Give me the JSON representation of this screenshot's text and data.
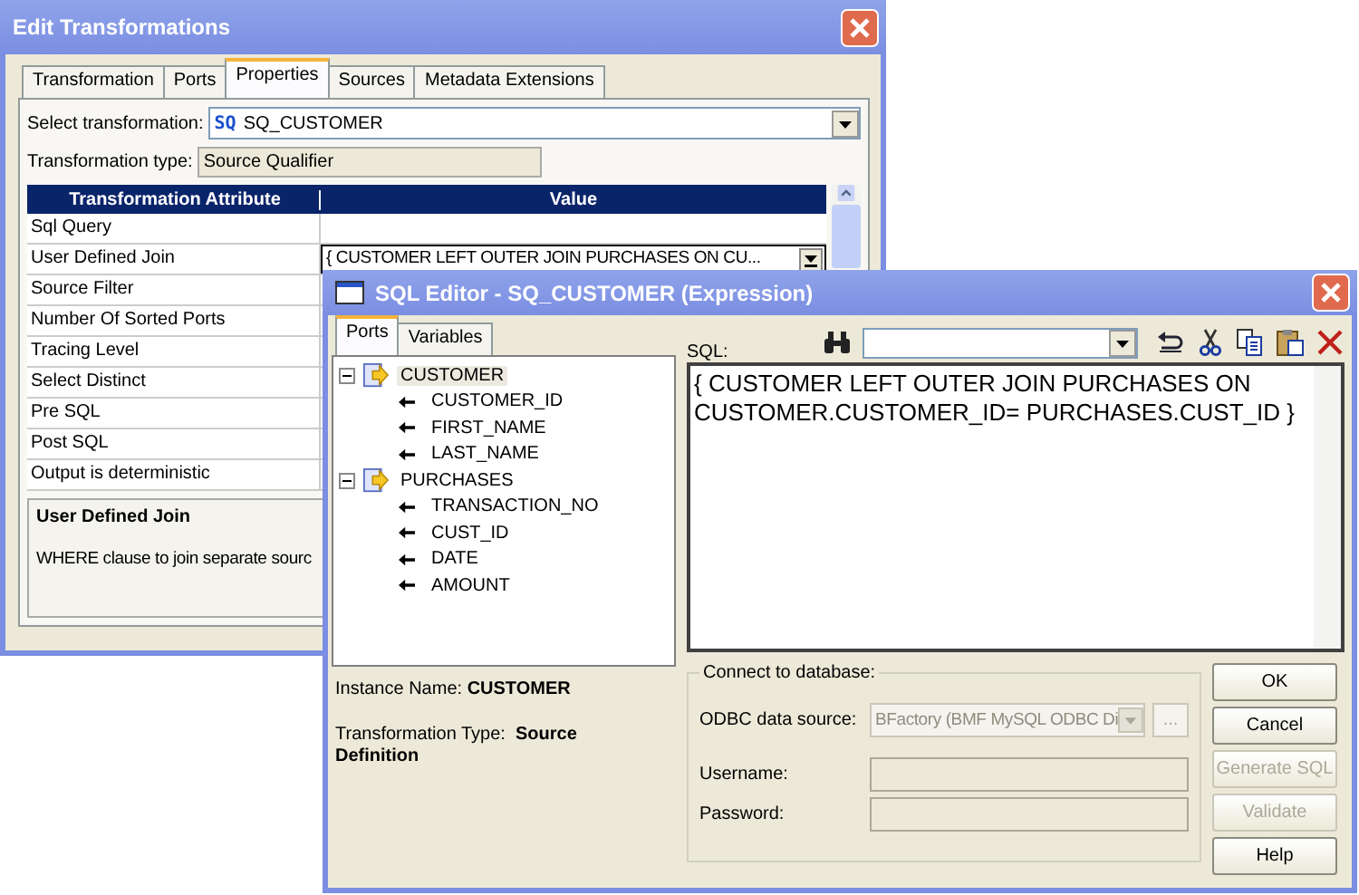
{
  "back_window": {
    "title": "Edit Transformations",
    "tabs": [
      {
        "label": "Transformation",
        "selected": false
      },
      {
        "label": "Ports",
        "selected": false
      },
      {
        "label": "Properties",
        "selected": true
      },
      {
        "label": "Sources",
        "selected": false
      },
      {
        "label": "Metadata Extensions",
        "selected": false
      }
    ],
    "select_transformation": {
      "label": "Select transformation:",
      "badge": "SQ",
      "value": "SQ_CUSTOMER"
    },
    "transformation_type": {
      "label": "Transformation type:",
      "value": "Source Qualifier"
    },
    "table": {
      "columns": [
        "Transformation Attribute",
        "Value"
      ],
      "rows": [
        {
          "attribute": "Sql Query"
        },
        {
          "attribute": "User Defined Join",
          "value": "{ CUSTOMER LEFT OUTER JOIN PURCHASES ON CU..."
        },
        {
          "attribute": "Source Filter"
        },
        {
          "attribute": "Number Of Sorted Ports"
        },
        {
          "attribute": "Tracing Level"
        },
        {
          "attribute": "Select Distinct"
        },
        {
          "attribute": "Pre SQL"
        },
        {
          "attribute": "Post SQL"
        },
        {
          "attribute": "Output is deterministic"
        }
      ]
    },
    "description": {
      "title": "User Defined Join",
      "text": "WHERE clause to join separate sourc"
    }
  },
  "front_window": {
    "title": "SQL Editor - SQ_CUSTOMER (Expression)",
    "tabs": [
      {
        "label": "Ports",
        "selected": true
      },
      {
        "label": "Variables",
        "selected": false
      }
    ],
    "tree": [
      {
        "label": "CUSTOMER",
        "selected": true,
        "expanded": true,
        "children": [
          {
            "label": "CUSTOMER_ID",
            "selected": false
          },
          {
            "label": "FIRST_NAME",
            "selected": false
          },
          {
            "label": "LAST_NAME",
            "selected": false
          }
        ]
      },
      {
        "label": "PURCHASES",
        "selected": false,
        "expanded": true,
        "children": [
          {
            "label": "TRANSACTION_NO",
            "selected": false
          },
          {
            "label": "CUST_ID",
            "selected": false
          },
          {
            "label": "DATE",
            "selected": false
          },
          {
            "label": "AMOUNT",
            "selected": false
          }
        ]
      }
    ],
    "instance_name": {
      "label": "Instance Name:",
      "value": "CUSTOMER"
    },
    "transformation_type": {
      "label": "Transformation Type:",
      "value": "Source Definition"
    },
    "sql_label": "SQL:",
    "sql_lines": [
      "{ CUSTOMER LEFT OUTER JOIN PURCHASES ON",
      "CUSTOMER.CUSTOMER_ID= PURCHASES.CUST_ID }"
    ],
    "connect": {
      "title": "Connect to database:",
      "odbc_label": "ODBC data source:",
      "odbc_value": "BFactory (BMF MySQL ODBC Di",
      "browse": "...",
      "username_label": "Username:",
      "password_label": "Password:"
    },
    "buttons": [
      {
        "label": "OK",
        "disabled": false
      },
      {
        "label": "Cancel",
        "disabled": false
      },
      {
        "label": "Generate SQL",
        "disabled": true
      },
      {
        "label": "Validate",
        "disabled": true
      },
      {
        "label": "Help",
        "disabled": false
      }
    ]
  }
}
